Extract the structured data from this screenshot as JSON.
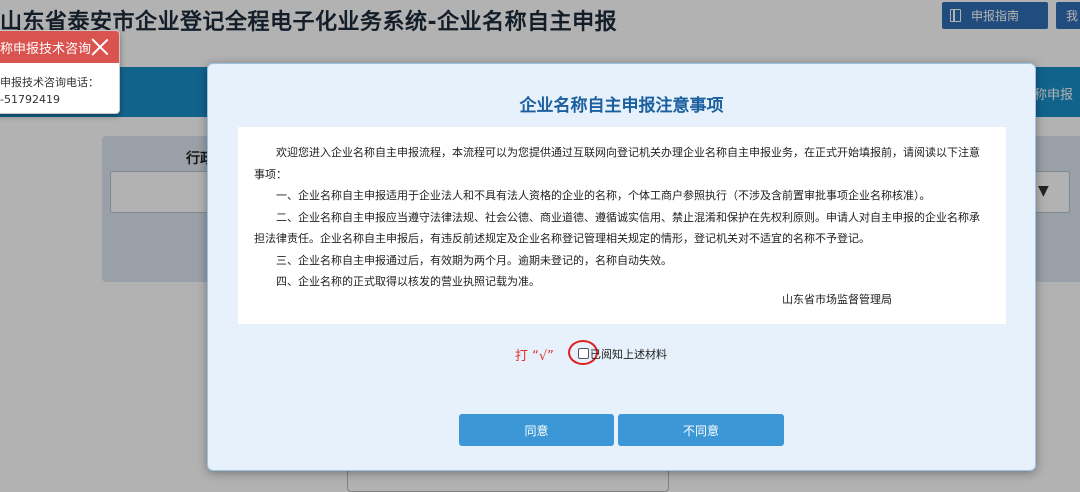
{
  "header": {
    "title": "山东省泰安市企业登记全程电子化业务系统-企业名称自主申报",
    "guide_button": "申报指南",
    "my_button": "我"
  },
  "background": {
    "band_right_label": "称申报",
    "region_label": "行政"
  },
  "consult_popup": {
    "title": "称申报技术咨询",
    "line1": "申报技术咨询电话：",
    "line2": "-51792419"
  },
  "modal": {
    "title": "企业名称自主申报注意事项",
    "paragraphs": [
      "欢迎您进入企业名称自主申报流程，本流程可以为您提供通过互联网向登记机关办理企业名称自主申报业务，在正式开始填报前，请阅读以下注意事项：",
      "一、企业名称自主申报适用于企业法人和不具有法人资格的企业的名称，个体工商户参照执行（不涉及含前置审批事项企业名称核准）。",
      "二、企业名称自主申报应当遵守法律法规、社会公德、商业道德、遵循诚实信用、禁止混淆和保护在先权利原则。申请人对自主申报的企业名称承担法律责任。企业名称自主申报后，有违反前述规定及企业名称登记管理相关规定的情形，登记机关对不适宜的名称不予登记。",
      "三、企业名称自主申报通过后，有效期为两个月。逾期未登记的，名称自动失效。",
      "四、企业名称的正式取得以核发的营业执照记载为准。"
    ],
    "signature": "山东省市场监督管理局",
    "annotation": "打 “√”",
    "checkbox_label": "已阅知上述材料",
    "agree_button": "同意",
    "disagree_button": "不同意"
  }
}
